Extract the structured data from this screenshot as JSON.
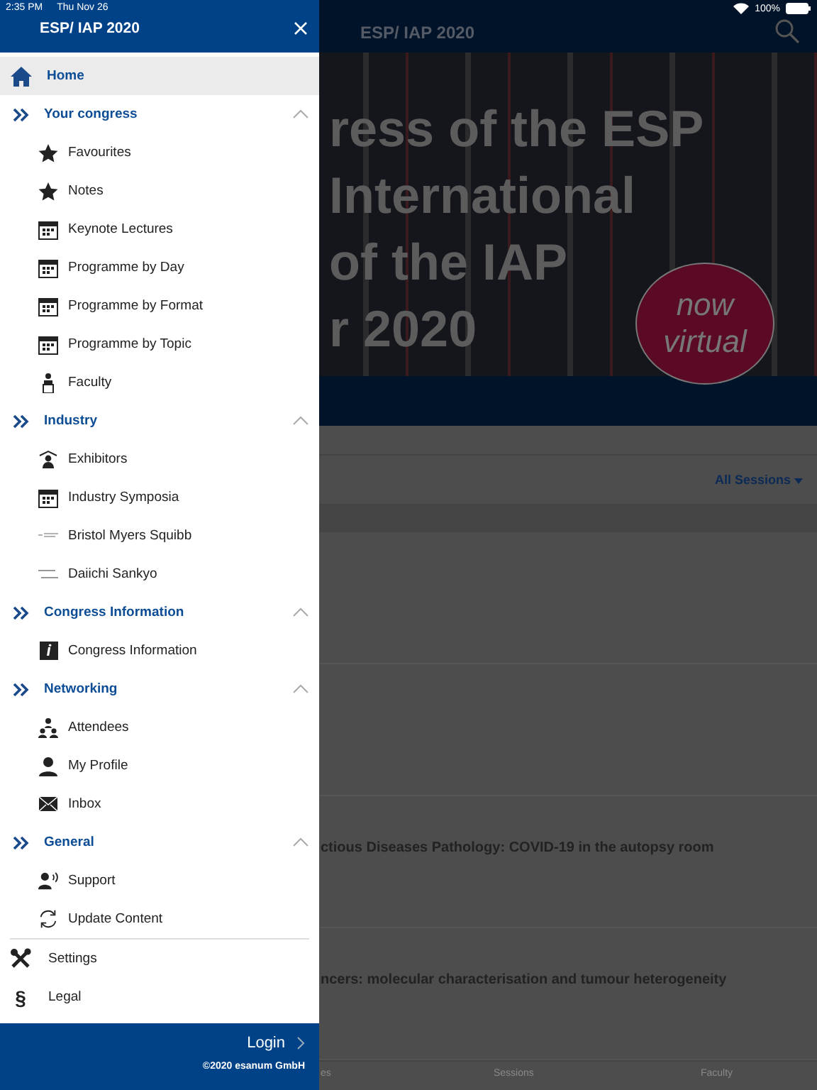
{
  "status_bar": {
    "time": "2:35 PM",
    "date": "Thu Nov 26",
    "battery": "100%"
  },
  "drawer": {
    "title": "ESP/ IAP 2020",
    "home": {
      "label": "Home",
      "selected": true
    },
    "sections": [
      {
        "label": "Your congress",
        "expanded": true,
        "items": [
          {
            "label": "Favourites",
            "kind": "star"
          },
          {
            "label": "Notes",
            "kind": "star"
          },
          {
            "label": "Keynote Lectures",
            "kind": "calendar"
          },
          {
            "label": "Programme by Day",
            "kind": "calendar"
          },
          {
            "label": "Programme by Format",
            "kind": "calendar"
          },
          {
            "label": "Programme by Topic",
            "kind": "calendar"
          },
          {
            "label": "Faculty",
            "kind": "speaker"
          }
        ]
      },
      {
        "label": "Industry",
        "expanded": true,
        "items": [
          {
            "label": "Exhibitors",
            "kind": "exhibitor"
          },
          {
            "label": "Industry Symposia",
            "kind": "calendar"
          },
          {
            "label": "Bristol Myers Squibb",
            "kind": "logo"
          },
          {
            "label": "Daiichi Sankyo",
            "kind": "logo2"
          }
        ]
      },
      {
        "label": "Congress Information",
        "expanded": true,
        "items": [
          {
            "label": "Congress Information",
            "kind": "info"
          }
        ]
      },
      {
        "label": "Networking",
        "expanded": true,
        "items": [
          {
            "label": "Attendees",
            "kind": "people"
          },
          {
            "label": "My Profile",
            "kind": "person"
          },
          {
            "label": "Inbox",
            "kind": "mail"
          }
        ]
      },
      {
        "label": "General",
        "expanded": true,
        "items": [
          {
            "label": "Support",
            "kind": "support"
          },
          {
            "label": "Update Content",
            "kind": "refresh"
          }
        ]
      }
    ],
    "bottom_items": [
      {
        "label": "Settings",
        "kind": "tools"
      },
      {
        "label": "Legal",
        "kind": "section",
        "symbol": "§"
      }
    ],
    "login": "Login",
    "copyright": "©2020 esanum GmbH"
  },
  "background": {
    "title": "ESP/ IAP 2020",
    "banner_lines": [
      "ress of the ESP",
      "International",
      "of the IAP",
      "r 2020"
    ],
    "bubble": [
      "now",
      "virtual"
    ],
    "filter": "All Sessions",
    "rows": [
      "",
      "",
      "ctious Diseases Pathology: COVID-19 in the autopsy room",
      "ncers: molecular characterisation and tumour heterogeneity"
    ],
    "tabs": [
      "es",
      "Sessions",
      "Faculty"
    ]
  }
}
